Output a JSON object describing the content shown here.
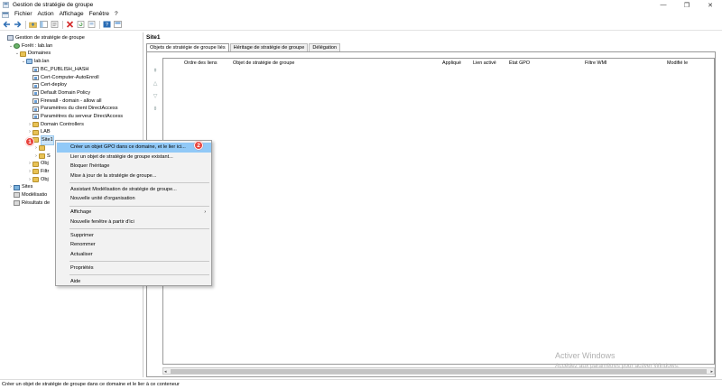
{
  "window": {
    "title": "Gestion de stratégie de groupe",
    "minimize": "—",
    "maximize": "❐",
    "close": "✕"
  },
  "menubar": [
    "Fichier",
    "Action",
    "Affichage",
    "Fenêtre",
    "?"
  ],
  "tree": [
    {
      "label": "Gestion de stratégie de groupe",
      "indent": 0,
      "expander": "",
      "icon": "root"
    },
    {
      "label": "Forêt : lab.lan",
      "indent": 1,
      "expander": "⌄",
      "icon": "forest"
    },
    {
      "label": "Domaines",
      "indent": 2,
      "expander": "⌄",
      "icon": "folder"
    },
    {
      "label": "lab.lan",
      "indent": 3,
      "expander": "⌄",
      "icon": "domain"
    },
    {
      "label": "BC_PUBLISH_HASH",
      "indent": 4,
      "expander": "",
      "icon": "gpo"
    },
    {
      "label": "Cert-Computer-AutoEnroll",
      "indent": 4,
      "expander": "",
      "icon": "gpo"
    },
    {
      "label": "Cert-deploy",
      "indent": 4,
      "expander": "",
      "icon": "gpo"
    },
    {
      "label": "Default Domain Policy",
      "indent": 4,
      "expander": "",
      "icon": "gpo"
    },
    {
      "label": "Firewall - domain - allow all",
      "indent": 4,
      "expander": "",
      "icon": "gpo"
    },
    {
      "label": "Paramètres du client DirectAccess",
      "indent": 4,
      "expander": "",
      "icon": "gpo"
    },
    {
      "label": "Paramètres du serveur DirectAccess",
      "indent": 4,
      "expander": "",
      "icon": "gpo"
    },
    {
      "label": "Domain Controllers",
      "indent": 4,
      "expander": "›",
      "icon": "ou"
    },
    {
      "label": "LAB",
      "indent": 4,
      "expander": "›",
      "icon": "ou"
    },
    {
      "label": "Site1",
      "indent": 4,
      "expander": "⌄",
      "icon": "ou",
      "selected": true
    },
    {
      "label": "",
      "indent": 5,
      "expander": "›",
      "icon": "ou"
    },
    {
      "label": "S",
      "indent": 5,
      "expander": "›",
      "icon": "ou"
    },
    {
      "label": "Obj",
      "indent": 4,
      "expander": "›",
      "icon": "folder"
    },
    {
      "label": "Filtr",
      "indent": 4,
      "expander": "›",
      "icon": "folder"
    },
    {
      "label": "Obj",
      "indent": 4,
      "expander": "›",
      "icon": "folder"
    },
    {
      "label": "Sites",
      "indent": 1,
      "expander": "›",
      "icon": "sites"
    },
    {
      "label": "Modélisatio",
      "indent": 1,
      "expander": "",
      "icon": "model"
    },
    {
      "label": "Résultats de",
      "indent": 1,
      "expander": "",
      "icon": "model"
    }
  ],
  "right": {
    "header": "Site1",
    "tabs": [
      "Objets de stratégie de groupe liés",
      "Héritage de stratégie de groupe",
      "Délégation"
    ],
    "columns": [
      "Ordre des liens",
      "Objet de stratégie de groupe",
      "Appliqué",
      "Lien activé",
      "État GPO",
      "Filtre WMI",
      "Modifié le"
    ]
  },
  "context_menu": {
    "items": [
      {
        "label": "Créer un objet GPO dans ce domaine, et le lier ici...",
        "hover": true
      },
      {
        "label": "Lier un objet de stratégie de groupe existant..."
      },
      {
        "label": "Bloquer l'héritage"
      },
      {
        "label": "Mise à jour de la stratégie de groupe..."
      },
      {
        "sep": true
      },
      {
        "label": "Assistant Modélisation de stratégie de groupe..."
      },
      {
        "label": "Nouvelle unité d'organisation"
      },
      {
        "sep": true
      },
      {
        "label": "Affichage",
        "submenu": true
      },
      {
        "label": "Nouvelle fenêtre à partir d'ici"
      },
      {
        "sep": true
      },
      {
        "label": "Supprimer"
      },
      {
        "label": "Renommer"
      },
      {
        "label": "Actualiser"
      },
      {
        "sep": true
      },
      {
        "label": "Propriétés"
      },
      {
        "sep": true
      },
      {
        "label": "Aide"
      }
    ],
    "submenu_glyph": "›"
  },
  "badges": {
    "one": "1",
    "two": "2"
  },
  "watermark": {
    "line1": "Activer Windows",
    "line2": "Accédez aux paramètres pour activer Windows."
  },
  "status": "Créer un objet de stratégie de groupe dans ce domaine et le lier à ce conteneur"
}
